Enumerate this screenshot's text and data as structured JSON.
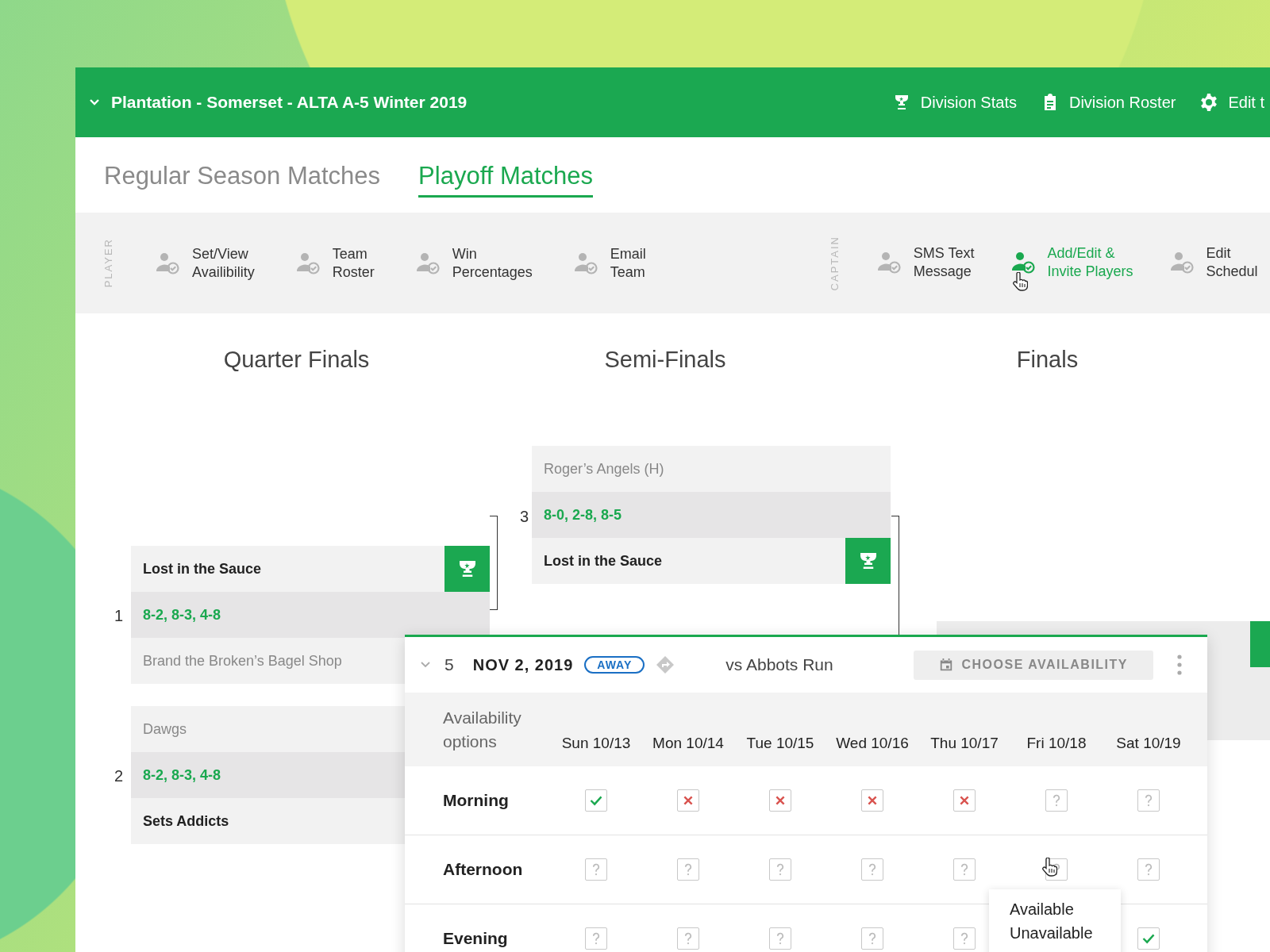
{
  "header": {
    "title": "Plantation - Somerset - ALTA A-5 Winter 2019",
    "links": [
      {
        "label": "Division Stats"
      },
      {
        "label": "Division Roster"
      },
      {
        "label": "Edit t"
      }
    ]
  },
  "tabs": [
    {
      "label": "Regular Season Matches",
      "selected": false
    },
    {
      "label": "Playoff Matches",
      "selected": true
    }
  ],
  "toolbar": [
    {
      "label": "PLAYER",
      "items": [
        {
          "lines": [
            "Set/View",
            "Availibility"
          ],
          "selected": false
        },
        {
          "lines": [
            "Team",
            "Roster"
          ],
          "selected": false
        },
        {
          "lines": [
            "Win",
            "Percentages"
          ],
          "selected": false
        },
        {
          "lines": [
            "Email",
            "Team"
          ],
          "selected": false
        }
      ]
    },
    {
      "label": "CAPTAIN",
      "items": [
        {
          "lines": [
            "SMS Text",
            "Message"
          ],
          "selected": false
        },
        {
          "lines": [
            "Add/Edit &",
            "Invite Players"
          ],
          "selected": true
        },
        {
          "lines": [
            "Edit",
            "Schedul"
          ],
          "selected": false
        }
      ]
    }
  ],
  "bracket": {
    "rounds": [
      {
        "title": "Quarter Finals"
      },
      {
        "title": "Semi-Finals"
      },
      {
        "title": "Finals"
      }
    ],
    "matches": [
      {
        "number": "1",
        "top": {
          "name": "Lost in the Sauce",
          "winner": true
        },
        "score": "8-2, 8-3, 4-8",
        "bottom": {
          "name": "Brand the Broken’s Bagel Shop",
          "winner": false
        }
      },
      {
        "number": "2",
        "top": {
          "name": "Dawgs",
          "winner": false
        },
        "score": "8-2, 8-3, 4-8",
        "bottom": {
          "name": "Sets Addicts",
          "winner": true
        }
      },
      {
        "number": "3",
        "top": {
          "name": "Roger’s Angels (H)",
          "winner": false
        },
        "score": "8-0, 2-8, 8-5",
        "bottom": {
          "name": "Lost in the Sauce",
          "winner": true
        }
      }
    ]
  },
  "match": {
    "number": "5",
    "date": "NOV 2, 2019",
    "venue": "AWAY",
    "opponent": "vs Abbots Run",
    "action": "CHOOSE AVAILABILITY",
    "options_label": [
      "Availability",
      "options"
    ],
    "days": [
      "Sun 10/13",
      "Mon 10/14",
      "Tue 10/15",
      "Wed 10/16",
      "Thu 10/17",
      "Fri 10/18",
      "Sat 10/19"
    ],
    "rows": [
      {
        "label": "Morning",
        "cells": [
          {
            "kind": "yes"
          },
          {
            "kind": "no"
          },
          {
            "kind": "no"
          },
          {
            "kind": "no"
          },
          {
            "kind": "no"
          },
          {
            "kind": "unknown"
          },
          {
            "kind": "unknown"
          }
        ]
      },
      {
        "label": "Afternoon",
        "cells": [
          {
            "kind": "unknown"
          },
          {
            "kind": "unknown"
          },
          {
            "kind": "unknown"
          },
          {
            "kind": "unknown"
          },
          {
            "kind": "unknown"
          },
          {
            "kind": "unknown"
          },
          {
            "kind": "unknown"
          }
        ]
      },
      {
        "label": "Evening",
        "cells": [
          {
            "kind": "unknown"
          },
          {
            "kind": "unknown"
          },
          {
            "kind": "unknown"
          },
          {
            "kind": "unknown"
          },
          {
            "kind": "unknown"
          },
          null,
          {
            "kind": "yes"
          }
        ]
      }
    ],
    "menu": [
      "Available",
      "Unavailable"
    ]
  }
}
